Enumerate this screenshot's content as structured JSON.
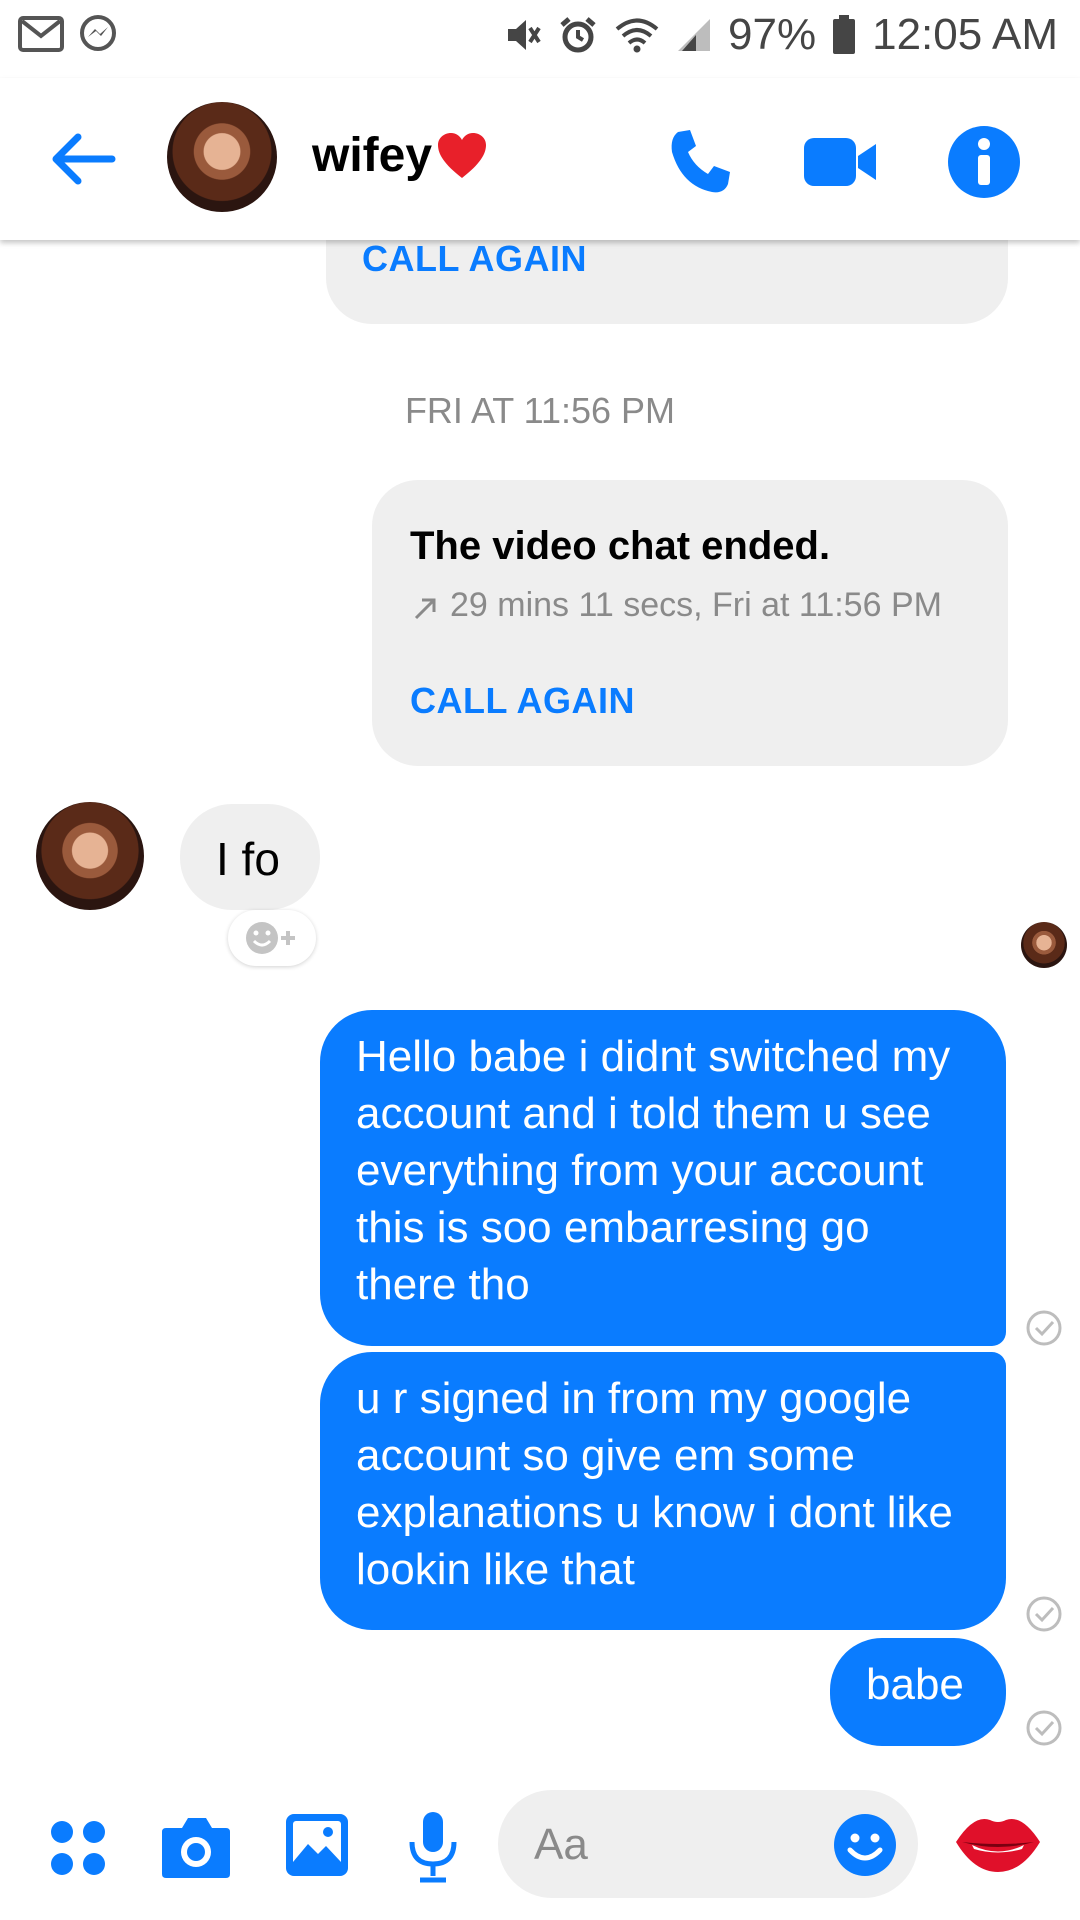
{
  "status_bar": {
    "battery": "97%",
    "time": "12:05 AM",
    "icons": [
      "gmail-icon",
      "messenger-icon",
      "mute-icon",
      "alarm-icon",
      "wifi-icon",
      "signal-icon",
      "battery-icon"
    ]
  },
  "header": {
    "title": "wifey",
    "title_emoji": "red-heart",
    "actions": [
      "back-arrow-icon",
      "phone-icon",
      "video-icon",
      "info-icon"
    ]
  },
  "messages": {
    "call_card_top": {
      "action": "CALL AGAIN"
    },
    "timestamp": "FRI AT 11:56 PM",
    "call_card": {
      "title": "The video chat ended.",
      "meta": "29 mins 11 secs, Fri at 11:56 PM",
      "action": "CALL AGAIN"
    },
    "incoming": [
      {
        "text": "I fo"
      }
    ],
    "outgoing": [
      {
        "text": "Hello babe i didnt switched my account and i told them u see everything from your account this is soo embarresing go there tho"
      },
      {
        "text": "u r signed in from my google account so give em some explanations u know i dont like lookin like that"
      },
      {
        "text": "babe"
      }
    ]
  },
  "composer": {
    "placeholder": "Aa",
    "icons": [
      "apps-icon",
      "camera-icon",
      "gallery-icon",
      "microphone-icon",
      "emoji-icon",
      "lips-icon"
    ]
  },
  "colors": {
    "accent": "#0a7cff",
    "bubble_gray": "#efefef",
    "meta_gray": "#8a8a8a"
  }
}
